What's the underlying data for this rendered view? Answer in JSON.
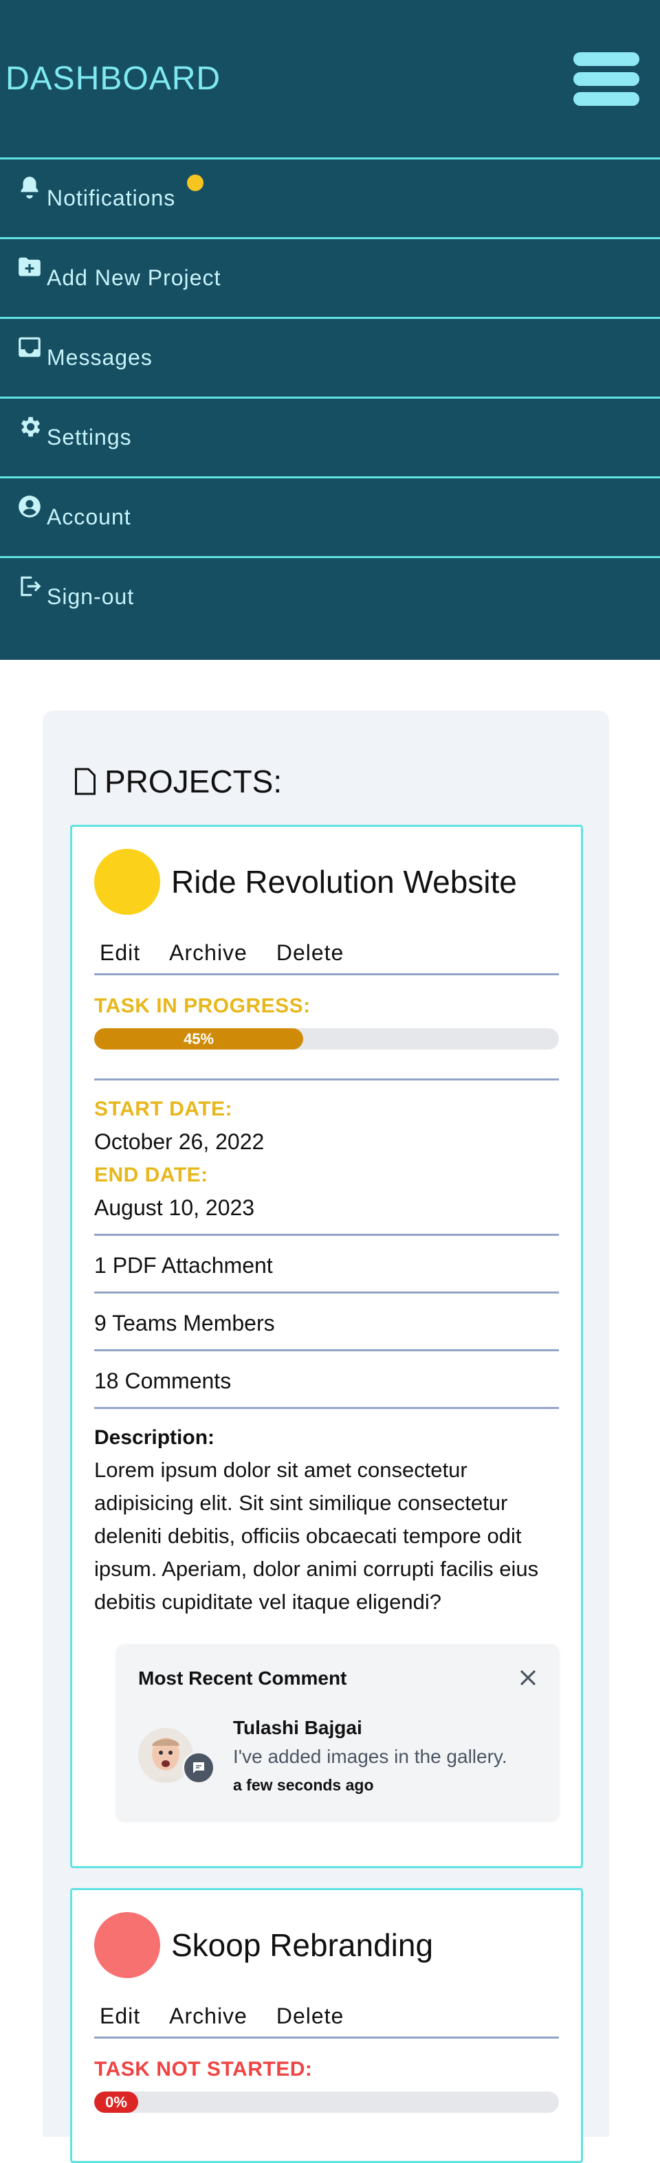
{
  "header": {
    "title": "DASHBOARD"
  },
  "menu": {
    "items": [
      {
        "label": "Notifications",
        "icon": "bell-icon",
        "has_badge": true
      },
      {
        "label": "Add New Project",
        "icon": "folder-plus-icon"
      },
      {
        "label": "Messages",
        "icon": "inbox-icon"
      },
      {
        "label": "Settings",
        "icon": "gear-icon"
      },
      {
        "label": "Account",
        "icon": "user-circle-icon"
      },
      {
        "label": "Sign-out",
        "icon": "sign-out-icon"
      }
    ]
  },
  "projects": {
    "title": "PROJECTS:",
    "cards": [
      {
        "name": "Ride Revolution Website",
        "color": "#fbd11a",
        "actions": {
          "edit": "Edit",
          "archive": "Archive",
          "delete": "Delete"
        },
        "status_label": "TASK IN PROGRESS:",
        "status_color": "#e8b71c",
        "progress_label": "45%",
        "progress_percent": 45,
        "progress_color": "#cf8b07",
        "start_label": "START DATE:",
        "start_date": "October 26, 2022",
        "end_label": "END DATE:",
        "end_date": "August 10, 2023",
        "attachments": "1 PDF Attachment",
        "members": "9 Teams Members",
        "comments": "18 Comments",
        "description_label": "Description:",
        "description": "Lorem ipsum dolor sit amet consectetur adipisicing elit. Sit sint similique consectetur deleniti debitis, officiis obcaecati tempore odit ipsum. Aperiam, dolor animi corrupti facilis eius debitis cupiditate vel itaque eligendi?",
        "recent_comment": {
          "title": "Most Recent Comment",
          "author": "Tulashi Bajgai",
          "text": "I've added images in the gallery.",
          "time": "a few seconds ago"
        }
      },
      {
        "name": "Skoop Rebranding",
        "color": "#f87171",
        "actions": {
          "edit": "Edit",
          "archive": "Archive",
          "delete": "Delete"
        },
        "status_label": "TASK NOT STARTED:",
        "status_color": "#ef4444",
        "progress_label": "0%",
        "progress_percent": 0,
        "progress_color": "#dc2626"
      }
    ]
  }
}
